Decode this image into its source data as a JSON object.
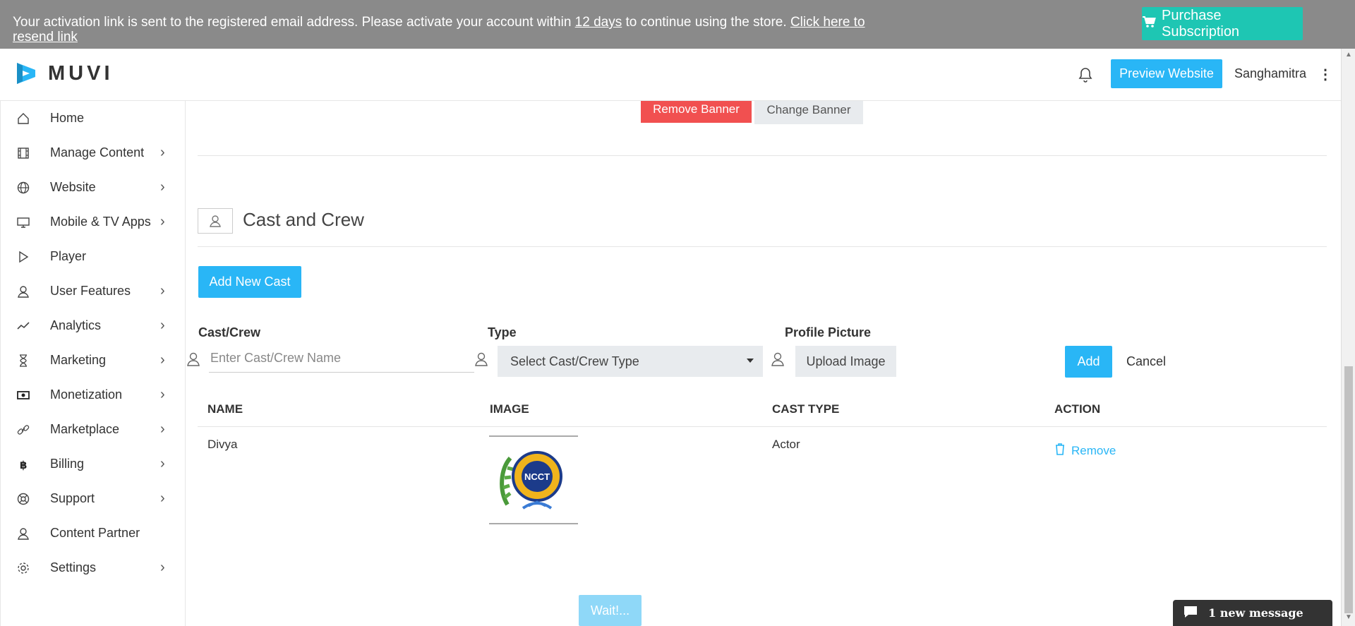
{
  "banner": {
    "text_before": "Your activation link is sent to the registered email address. Please activate your account within ",
    "days_link": "12 days",
    "text_after": " to continue using the store. ",
    "resend_link": "Click here to resend link",
    "purchase_label": "Purchase Subscription"
  },
  "header": {
    "logo_text": "MUVI",
    "preview_label": "Preview Website",
    "username": "Sanghamitra",
    "kebab": "⋮"
  },
  "sidebar": {
    "items": [
      {
        "label": "Home",
        "icon": "home-icon",
        "chevron": ""
      },
      {
        "label": "Manage Content",
        "icon": "film-icon",
        "chevron": "›"
      },
      {
        "label": "Website",
        "icon": "globe-icon",
        "chevron": "›"
      },
      {
        "label": "Mobile & TV Apps",
        "icon": "monitor-icon",
        "chevron": "›"
      },
      {
        "label": "Player",
        "icon": "play-icon",
        "chevron": ""
      },
      {
        "label": "User Features",
        "icon": "user-icon",
        "chevron": "›"
      },
      {
        "label": "Analytics",
        "icon": "chart-line-icon",
        "chevron": "›"
      },
      {
        "label": "Marketing",
        "icon": "hourglass-icon",
        "chevron": "›"
      },
      {
        "label": "Monetization",
        "icon": "money-icon",
        "chevron": "›"
      },
      {
        "label": "Marketplace",
        "icon": "link-icon",
        "chevron": "›"
      },
      {
        "label": "Billing",
        "icon": "bitcoin-icon",
        "chevron": "›"
      },
      {
        "label": "Support",
        "icon": "lifebuoy-icon",
        "chevron": "›"
      },
      {
        "label": "Content Partner",
        "icon": "partner-icon",
        "chevron": ""
      },
      {
        "label": "Settings",
        "icon": "gear-icon",
        "chevron": "›"
      }
    ]
  },
  "banner_actions": {
    "remove_label": "Remove Banner",
    "change_label": "Change Banner"
  },
  "section": {
    "title": "Cast and Crew",
    "add_new_label": "Add New Cast"
  },
  "form": {
    "cast_label": "Cast/Crew",
    "cast_placeholder": "Enter Cast/Crew Name",
    "type_label": "Type",
    "type_selected": "Select Cast/Crew Type",
    "picture_label": "Profile Picture",
    "upload_label": "Upload Image",
    "add_label": "Add",
    "cancel_label": "Cancel"
  },
  "table": {
    "headers": [
      "NAME",
      "IMAGE",
      "CAST TYPE",
      "ACTION"
    ],
    "rows": [
      {
        "name": "Divya",
        "image_alt": "NCCT",
        "cast_type": "Actor",
        "action": "Remove"
      }
    ]
  },
  "wait_label": "Wait!...",
  "chat": {
    "label": "1 new message"
  },
  "colors": {
    "accent": "#29b6f6",
    "danger": "#f15050",
    "teal": "#1ec6b3"
  }
}
